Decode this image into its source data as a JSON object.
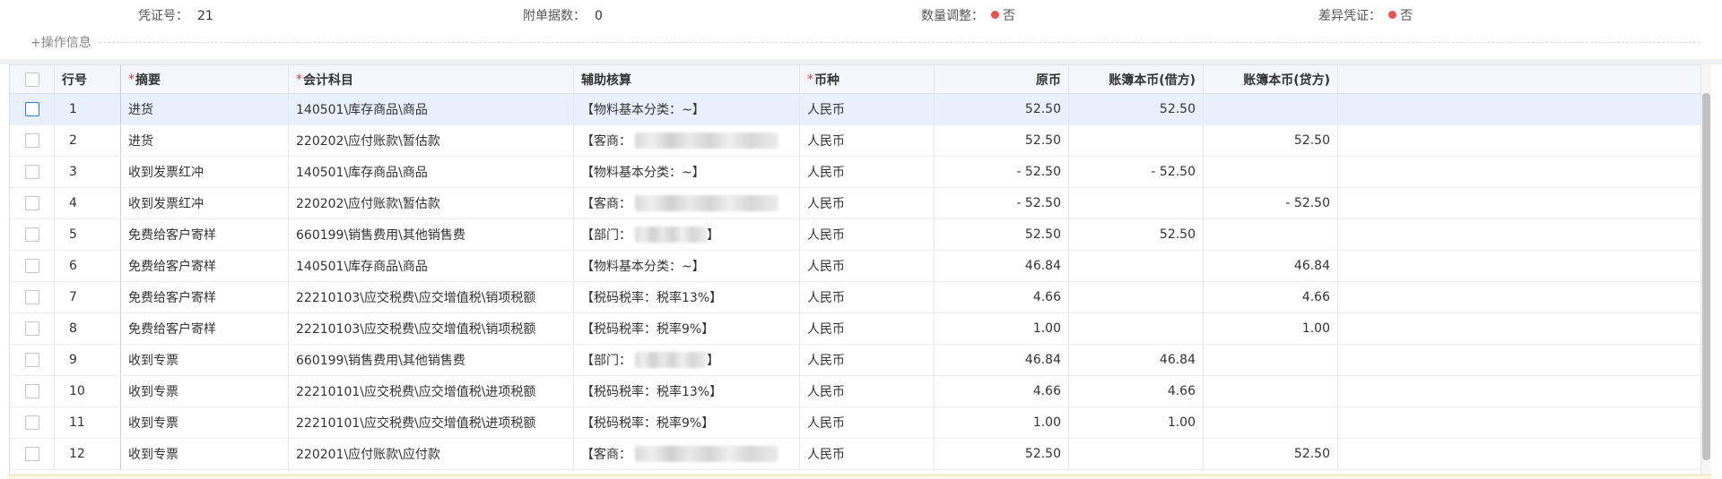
{
  "header": {
    "voucher_no_label": "凭证号：",
    "voucher_no_value": "21",
    "attachments_label": "附单据数：",
    "attachments_value": "0",
    "qty_adjust_label": "数量调整：",
    "qty_adjust_value": "否",
    "diff_voucher_label": "差异凭证：",
    "diff_voucher_value": "否",
    "status_dot_color": "#f0504d"
  },
  "ops": {
    "label": "+操作信息"
  },
  "table": {
    "columns": {
      "row_no": "行号",
      "summary": "摘要",
      "account": "会计科目",
      "aux": "辅助核算",
      "currency": "币种",
      "orig": "原币",
      "debit": "账簿本币(借方)",
      "credit": "账簿本币(贷方)"
    },
    "required_mark": "*",
    "rows": [
      {
        "no": "1",
        "summary": "进货",
        "account": "140501\\库存商品\\商品",
        "aux": "【物料基本分类：~】",
        "currency": "人民币",
        "orig": "52.50",
        "debit": "52.50",
        "credit": ""
      },
      {
        "no": "2",
        "summary": "进货",
        "account": "220202\\应付账款\\暂估款",
        "aux": "【客商：",
        "currency": "人民币",
        "orig": "52.50",
        "debit": "",
        "credit": "52.50"
      },
      {
        "no": "3",
        "summary": "收到发票红冲",
        "account": "140501\\库存商品\\商品",
        "aux": "【物料基本分类：~】",
        "currency": "人民币",
        "orig": "- 52.50",
        "debit": "- 52.50",
        "credit": ""
      },
      {
        "no": "4",
        "summary": "收到发票红冲",
        "account": "220202\\应付账款\\暂估款",
        "aux": "【客商：",
        "currency": "人民币",
        "orig": "- 52.50",
        "debit": "",
        "credit": "- 52.50"
      },
      {
        "no": "5",
        "summary": "免费给客户寄样",
        "account": "660199\\销售费用\\其他销售费",
        "aux": "【部门：",
        "currency": "人民币",
        "orig": "52.50",
        "debit": "52.50",
        "credit": ""
      },
      {
        "no": "6",
        "summary": "免费给客户寄样",
        "account": "140501\\库存商品\\商品",
        "aux": "【物料基本分类：~】",
        "currency": "人民币",
        "orig": "46.84",
        "debit": "",
        "credit": "46.84"
      },
      {
        "no": "7",
        "summary": "免费给客户寄样",
        "account": "22210103\\应交税费\\应交增值税\\销项税额",
        "aux": "【税码税率：税率13%】",
        "currency": "人民币",
        "orig": "4.66",
        "debit": "",
        "credit": "4.66"
      },
      {
        "no": "8",
        "summary": "免费给客户寄样",
        "account": "22210103\\应交税费\\应交增值税\\销项税额",
        "aux": "【税码税率：税率9%】",
        "currency": "人民币",
        "orig": "1.00",
        "debit": "",
        "credit": "1.00"
      },
      {
        "no": "9",
        "summary": "收到专票",
        "account": "660199\\销售费用\\其他销售费",
        "aux": "【部门：",
        "currency": "人民币",
        "orig": "46.84",
        "debit": "46.84",
        "credit": ""
      },
      {
        "no": "10",
        "summary": "收到专票",
        "account": "22210101\\应交税费\\应交增值税\\进项税额",
        "aux": "【税码税率：税率13%】",
        "currency": "人民币",
        "orig": "4.66",
        "debit": "4.66",
        "credit": ""
      },
      {
        "no": "11",
        "summary": "收到专票",
        "account": "22210101\\应交税费\\应交增值税\\进项税额",
        "aux": "【税码税率：税率9%】",
        "currency": "人民币",
        "orig": "1.00",
        "debit": "1.00",
        "credit": ""
      },
      {
        "no": "12",
        "summary": "收到专票",
        "account": "220201\\应付账款\\应付款",
        "aux": "【客商：",
        "currency": "人民币",
        "orig": "52.50",
        "debit": "",
        "credit": "52.50"
      }
    ],
    "dept_close": "】"
  }
}
